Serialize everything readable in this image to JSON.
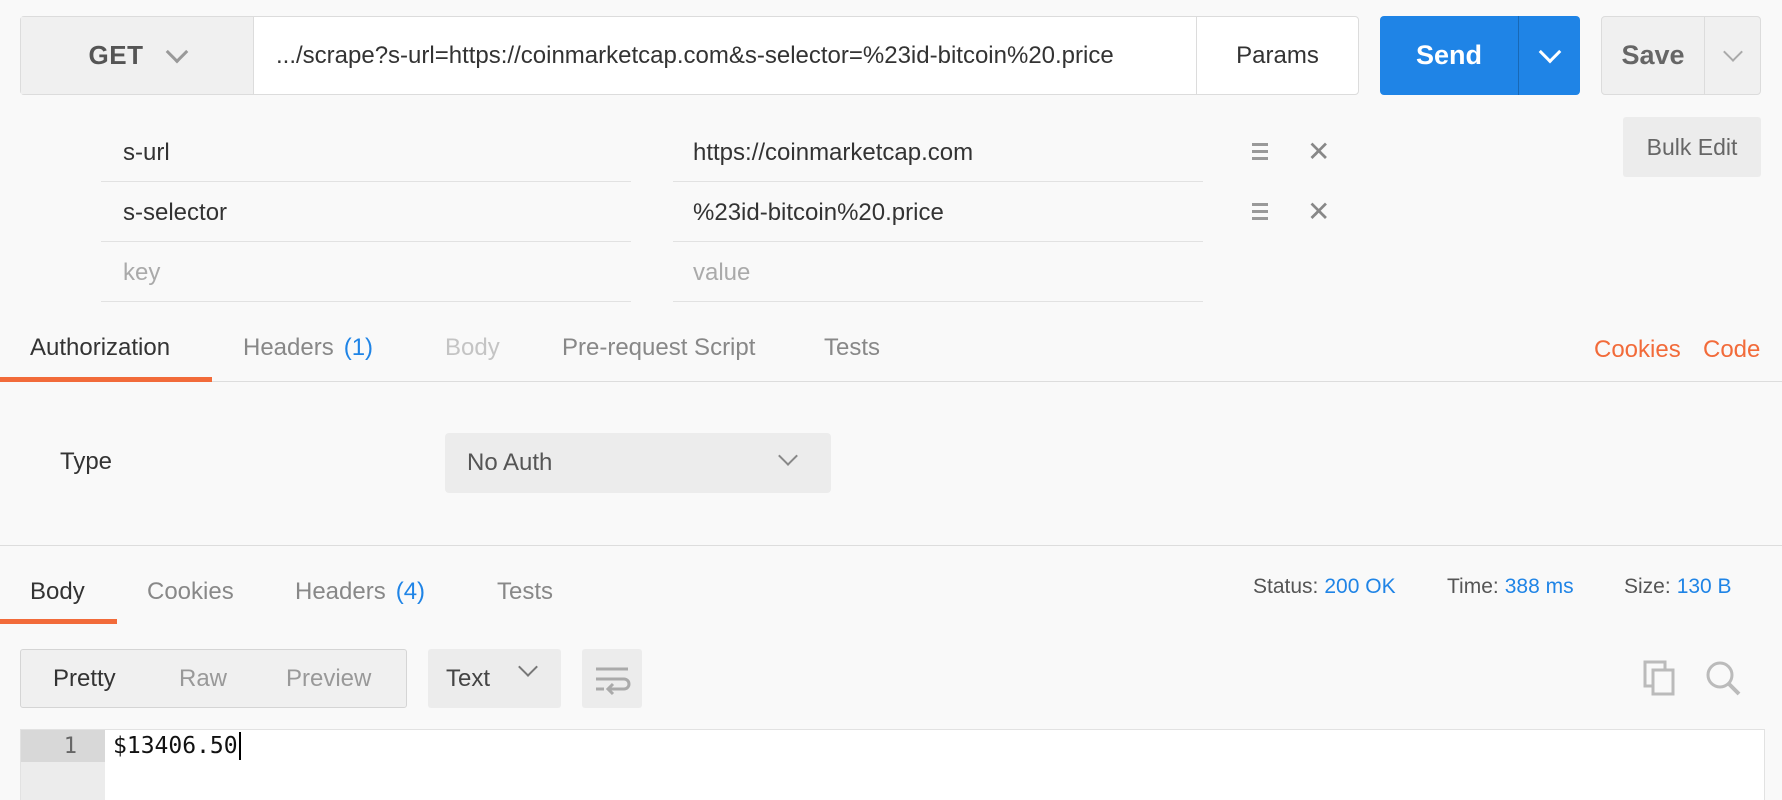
{
  "request": {
    "method": "GET",
    "url": ".../scrape?s-url=https://coinmarketcap.com&s-selector=%23id-bitcoin%20.price",
    "params_label": "Params",
    "send_label": "Send",
    "save_label": "Save"
  },
  "params": {
    "rows": [
      {
        "key": "s-url",
        "value": "https://coinmarketcap.com"
      },
      {
        "key": "s-selector",
        "value": "%23id-bitcoin%20.price"
      }
    ],
    "key_placeholder": "key",
    "value_placeholder": "value",
    "bulk_edit_label": "Bulk Edit"
  },
  "request_tabs": {
    "authorization": "Authorization",
    "headers": "Headers",
    "headers_count": "(1)",
    "body": "Body",
    "prerequest": "Pre-request Script",
    "tests": "Tests",
    "cookies_link": "Cookies",
    "code_link": "Code"
  },
  "auth": {
    "type_label": "Type",
    "selected": "No Auth"
  },
  "response_tabs": {
    "body": "Body",
    "cookies": "Cookies",
    "headers": "Headers",
    "headers_count": "(4)",
    "tests": "Tests"
  },
  "response_meta": {
    "status_label": "Status:",
    "status_value": "200 OK",
    "time_label": "Time:",
    "time_value": "388 ms",
    "size_label": "Size:",
    "size_value": "130 B"
  },
  "view_modes": {
    "pretty": "Pretty",
    "raw": "Raw",
    "preview": "Preview",
    "format": "Text"
  },
  "response_body": {
    "line_number": "1",
    "content": "$13406.50"
  },
  "icons": {
    "method_dropdown": "chevron-down-icon",
    "send_dropdown": "chevron-down-icon",
    "save_dropdown": "chevron-down-icon",
    "drag": "drag-handle-icon",
    "remove": "close-icon",
    "wrap": "wrap-lines-icon",
    "copy": "copy-icon",
    "search": "search-icon"
  },
  "colors": {
    "accent_blue": "#1f84e6",
    "accent_orange": "#f26b3a"
  }
}
